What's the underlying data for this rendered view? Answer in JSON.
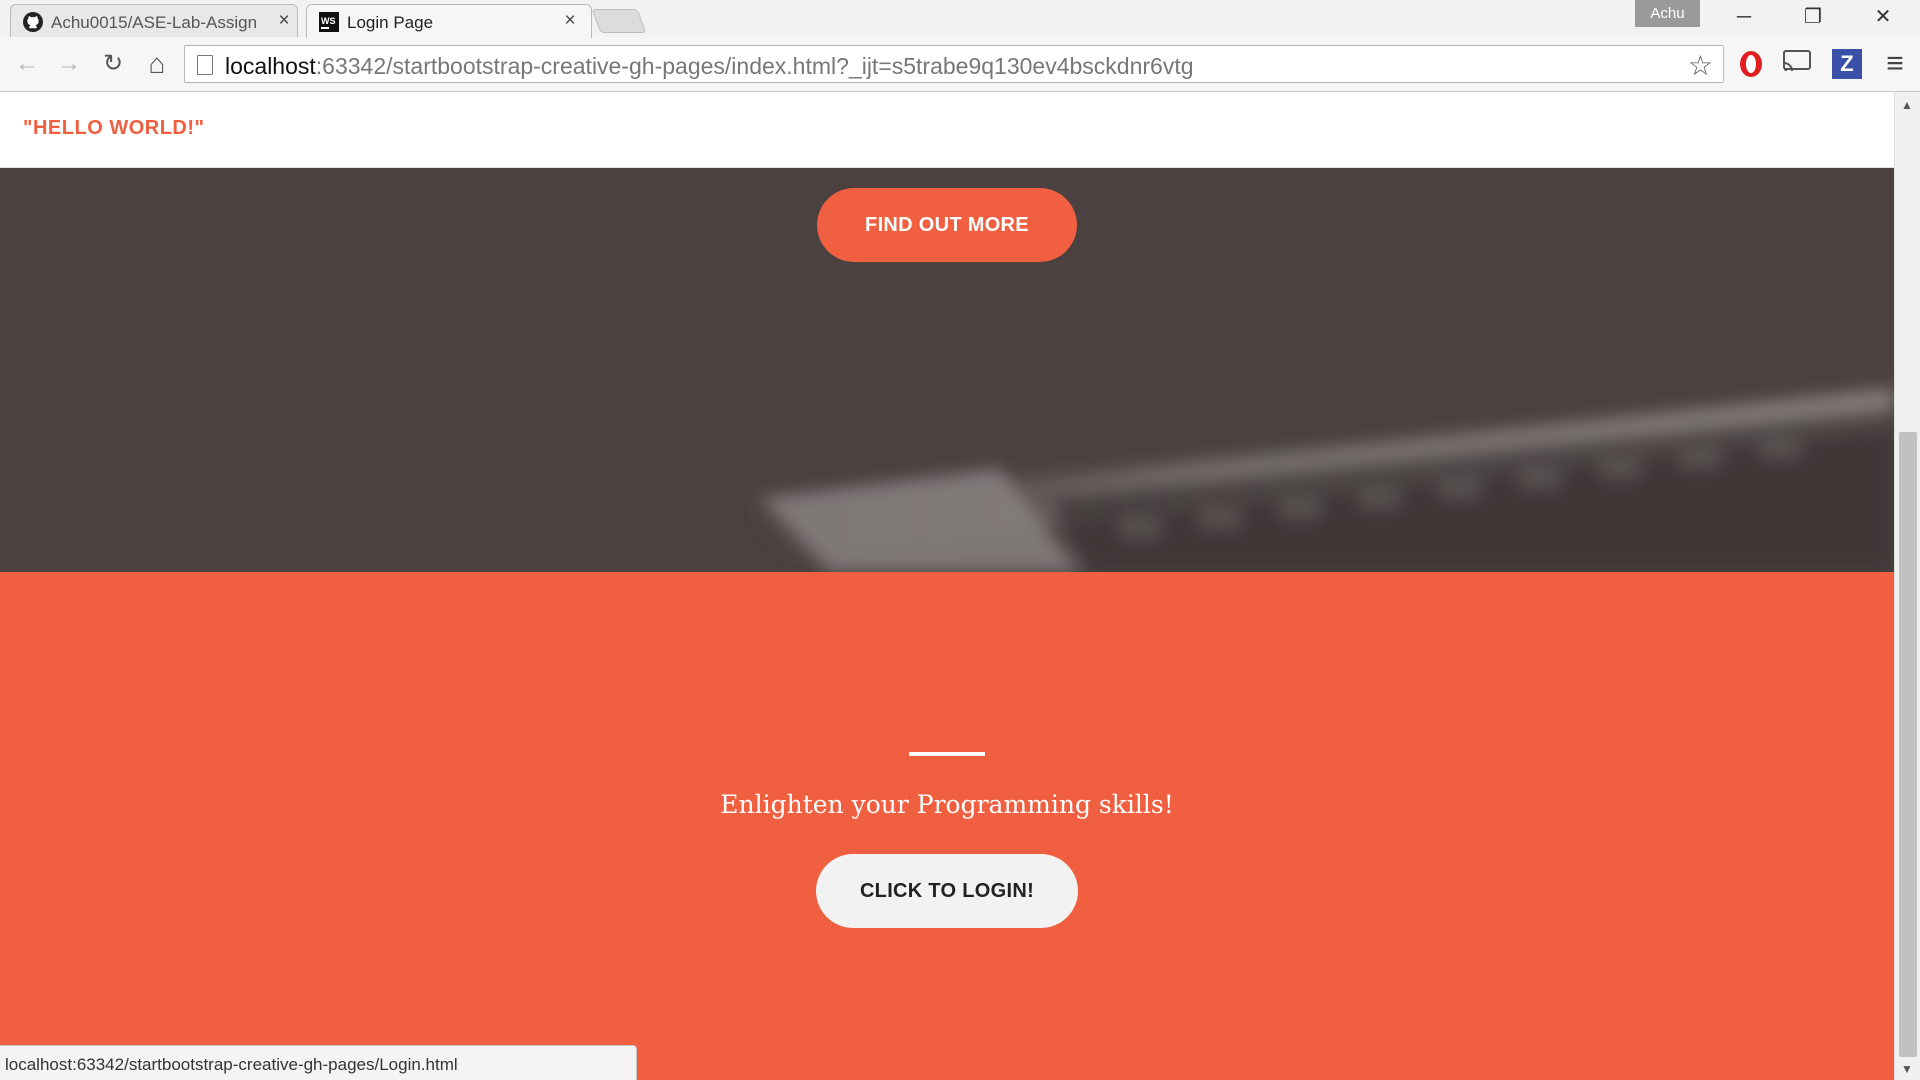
{
  "browser": {
    "tabs": [
      {
        "title": "Achu0015/ASE-Lab-Assign",
        "icon": "github-icon",
        "active": false
      },
      {
        "title": "Login Page",
        "icon": "webstorm-icon",
        "active": true
      }
    ],
    "close_glyph": "×",
    "profile_name": "Achu",
    "window_controls": {
      "minimize": "─",
      "restore": "❐",
      "close": "✕"
    },
    "nav": {
      "back": "←",
      "forward": "→",
      "reload": "↻",
      "home": "⌂"
    },
    "address": {
      "host": "localhost",
      "path": ":63342/startbootstrap-creative-gh-pages/index.html?_ijt=s5trabe9q130ev4bsckdnr6vtg"
    },
    "star_glyph": "☆",
    "extensions": [
      {
        "name": "opera-extension-icon",
        "glyph": "O",
        "color": "#e02020"
      },
      {
        "name": "cast-icon",
        "glyph": "⌸",
        "color": "#555555"
      },
      {
        "name": "z-extension-icon",
        "glyph": "Z",
        "color": "#3a4fa8"
      },
      {
        "name": "menu-icon",
        "glyph": "≡",
        "color": "#444444"
      }
    ],
    "status_url": "localhost:63342/startbootstrap-creative-gh-pages/Login.html"
  },
  "page": {
    "brand": "\"HELLO WORLD!\"",
    "hero_button": "FIND OUT MORE",
    "cta_text": "Enlighten your Programming skills!",
    "cta_button": "CLICK TO LOGIN!"
  },
  "colors": {
    "accent": "#f05f40",
    "hero_bg": "#4a4140",
    "light_button": "#f2f2f2"
  },
  "scrollbar": {
    "up": "▲",
    "down": "▼"
  }
}
